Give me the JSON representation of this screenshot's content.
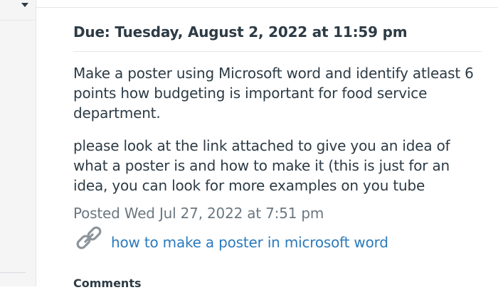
{
  "assignment": {
    "due": "Due: Tuesday, August 2, 2022 at 11:59 pm",
    "description": [
      "Make a poster using Microsoft word and identify atleast 6 points how budgeting is important for food service department.",
      "please look at the link attached to give you an idea of what a poster is and how to make it (this is just for an idea, you can look for more examples on you tube"
    ],
    "posted": "Posted Wed Jul 27, 2022 at 7:51 pm",
    "attachment": {
      "icon": "link-icon",
      "label": "how to make a poster in microsoft word"
    }
  },
  "comments": {
    "heading": "Comments"
  },
  "colors": {
    "text": "#2d3b45",
    "muted": "#6b7780",
    "link": "#2b7abc",
    "divider": "#e3e6e8"
  }
}
